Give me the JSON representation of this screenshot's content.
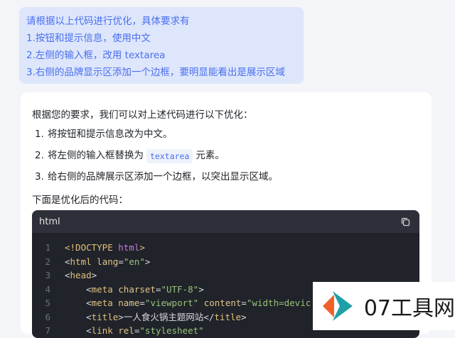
{
  "user_message": {
    "lines": [
      "请根据以上代码进行优化，具体要求有",
      "1.按钮和提示信息，使用中文",
      "2.左侧的输入框，改用 textarea",
      "3.右侧的品牌显示区添加一个边框，要明显能看出是展示区域"
    ]
  },
  "answer": {
    "intro": "根据您的要求，我们可以对上述代码进行以下优化：",
    "items": [
      {
        "num": "1.",
        "text": "将按钮和提示信息改为中文。"
      },
      {
        "num": "2.",
        "before": "将左侧的输入框替换为",
        "code": "textarea",
        "after": "元素。"
      },
      {
        "num": "3.",
        "text": "给右侧的品牌展示区添加一个边框，以突出显示区域。"
      }
    ],
    "below_text": "下面是优化后的代码："
  },
  "codeblock": {
    "language": "html",
    "copy_icon": "copy-icon",
    "lines": [
      {
        "n": "1",
        "parts": [
          [
            "doc",
            "<!DOCTYPE "
          ],
          [
            "kw",
            "html"
          ],
          [
            "doc",
            ">"
          ]
        ]
      },
      {
        "n": "2",
        "parts": [
          [
            "punc",
            "<"
          ],
          [
            "tag",
            "html"
          ],
          [
            "text",
            " "
          ],
          [
            "attr",
            "lang"
          ],
          [
            "punc",
            "="
          ],
          [
            "str",
            "\"en\""
          ],
          [
            "punc",
            ">"
          ]
        ]
      },
      {
        "n": "3",
        "parts": [
          [
            "punc",
            "<"
          ],
          [
            "tag",
            "head"
          ],
          [
            "punc",
            ">"
          ]
        ]
      },
      {
        "n": "4",
        "parts": [
          [
            "text",
            "    "
          ],
          [
            "punc",
            "<"
          ],
          [
            "tag",
            "meta"
          ],
          [
            "text",
            " "
          ],
          [
            "attr",
            "charset"
          ],
          [
            "punc",
            "="
          ],
          [
            "str",
            "\"UTF-8\""
          ],
          [
            "punc",
            ">"
          ]
        ]
      },
      {
        "n": "5",
        "parts": [
          [
            "text",
            "    "
          ],
          [
            "punc",
            "<"
          ],
          [
            "tag",
            "meta"
          ],
          [
            "text",
            " "
          ],
          [
            "attr",
            "name"
          ],
          [
            "punc",
            "="
          ],
          [
            "str",
            "\"viewport\""
          ],
          [
            "text",
            " "
          ],
          [
            "attr",
            "content"
          ],
          [
            "punc",
            "="
          ],
          [
            "str",
            "\"width=devic"
          ]
        ]
      },
      {
        "n": "6",
        "parts": [
          [
            "text",
            "    "
          ],
          [
            "punc",
            "<"
          ],
          [
            "tag",
            "title"
          ],
          [
            "punc",
            ">"
          ],
          [
            "text",
            "一人食火锅主题网站"
          ],
          [
            "punc",
            "</"
          ],
          [
            "tag",
            "title"
          ],
          [
            "punc",
            ">"
          ]
        ]
      },
      {
        "n": "7",
        "parts": [
          [
            "text",
            "    "
          ],
          [
            "punc",
            "<"
          ],
          [
            "tag",
            "link"
          ],
          [
            "text",
            " "
          ],
          [
            "attr",
            "rel"
          ],
          [
            "punc",
            "="
          ],
          [
            "str",
            "\"stylesheet\""
          ]
        ]
      }
    ]
  },
  "watermark": {
    "text": "07工具网",
    "colors": {
      "orange": "#f0612a",
      "teal": "#1fa0a8"
    }
  }
}
